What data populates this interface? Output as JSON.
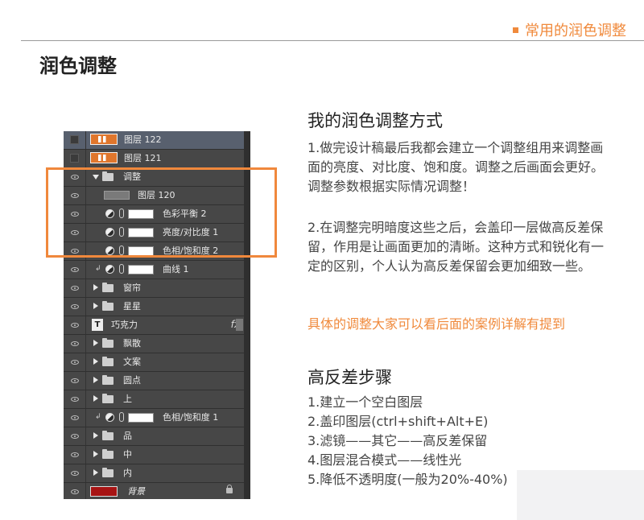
{
  "header": {
    "section_label": "常用的润色调整"
  },
  "page_title": "润色调整",
  "layers": [
    {
      "name": "图层 122",
      "kind": "image",
      "visible": false,
      "selected": true
    },
    {
      "name": "图层 121",
      "kind": "image",
      "visible": false
    },
    {
      "name": "调整",
      "kind": "group-open",
      "visible": true
    },
    {
      "name": "图层 120",
      "kind": "grey",
      "visible": true
    },
    {
      "name": "色彩平衡 2",
      "kind": "adjust",
      "visible": true
    },
    {
      "name": "亮度/对比度 1",
      "kind": "adjust",
      "visible": true
    },
    {
      "name": "色相/饱和度 2",
      "kind": "adjust",
      "visible": true
    },
    {
      "name": "曲线 1",
      "kind": "adjust-clip",
      "visible": true
    },
    {
      "name": "窗帘",
      "kind": "group",
      "visible": true
    },
    {
      "name": "星星",
      "kind": "group",
      "visible": true
    },
    {
      "name": "巧克力",
      "kind": "text-fx",
      "visible": true,
      "fx": "fx"
    },
    {
      "name": "飘散",
      "kind": "group",
      "visible": true
    },
    {
      "name": "文案",
      "kind": "group",
      "visible": true
    },
    {
      "name": "圆点",
      "kind": "group",
      "visible": true
    },
    {
      "name": "上",
      "kind": "group",
      "visible": true
    },
    {
      "name": "色相/饱和度 1",
      "kind": "adjust-clip",
      "visible": true
    },
    {
      "name": "品",
      "kind": "group",
      "visible": true
    },
    {
      "name": "中",
      "kind": "group",
      "visible": true
    },
    {
      "name": "内",
      "kind": "group",
      "visible": true
    },
    {
      "name": "背景",
      "kind": "background",
      "visible": true
    }
  ],
  "section1": {
    "title": "我的润色调整方式",
    "p1": "1.做完设计稿最后我都会建立一个调整组用来调整画面的亮度、对比度、饱和度。调整之后画面会更好。调整参数根据实际情况调整！",
    "p2": "2.在调整完明暗度这些之后，会盖印一层做高反差保留，作用是让画面更加的清晰。这种方式和锐化有一定的区别，个人认为高反差保留会更加细致一些。",
    "note": "具体的调整大家可以看后面的案例详解有提到"
  },
  "section2": {
    "title": "高反差步骤",
    "steps": [
      "1.建立一个空白图层",
      "2.盖印图层(ctrl+shift+Alt+E)",
      "3.滤镜——其它——高反差保留",
      "4.图层混合模式——线性光",
      "5.降低不透明度(一般为20%-40%)"
    ]
  },
  "colors": {
    "accent": "#f08a3c",
    "panel_bg": "#424242",
    "selected_row": "#58606e"
  }
}
